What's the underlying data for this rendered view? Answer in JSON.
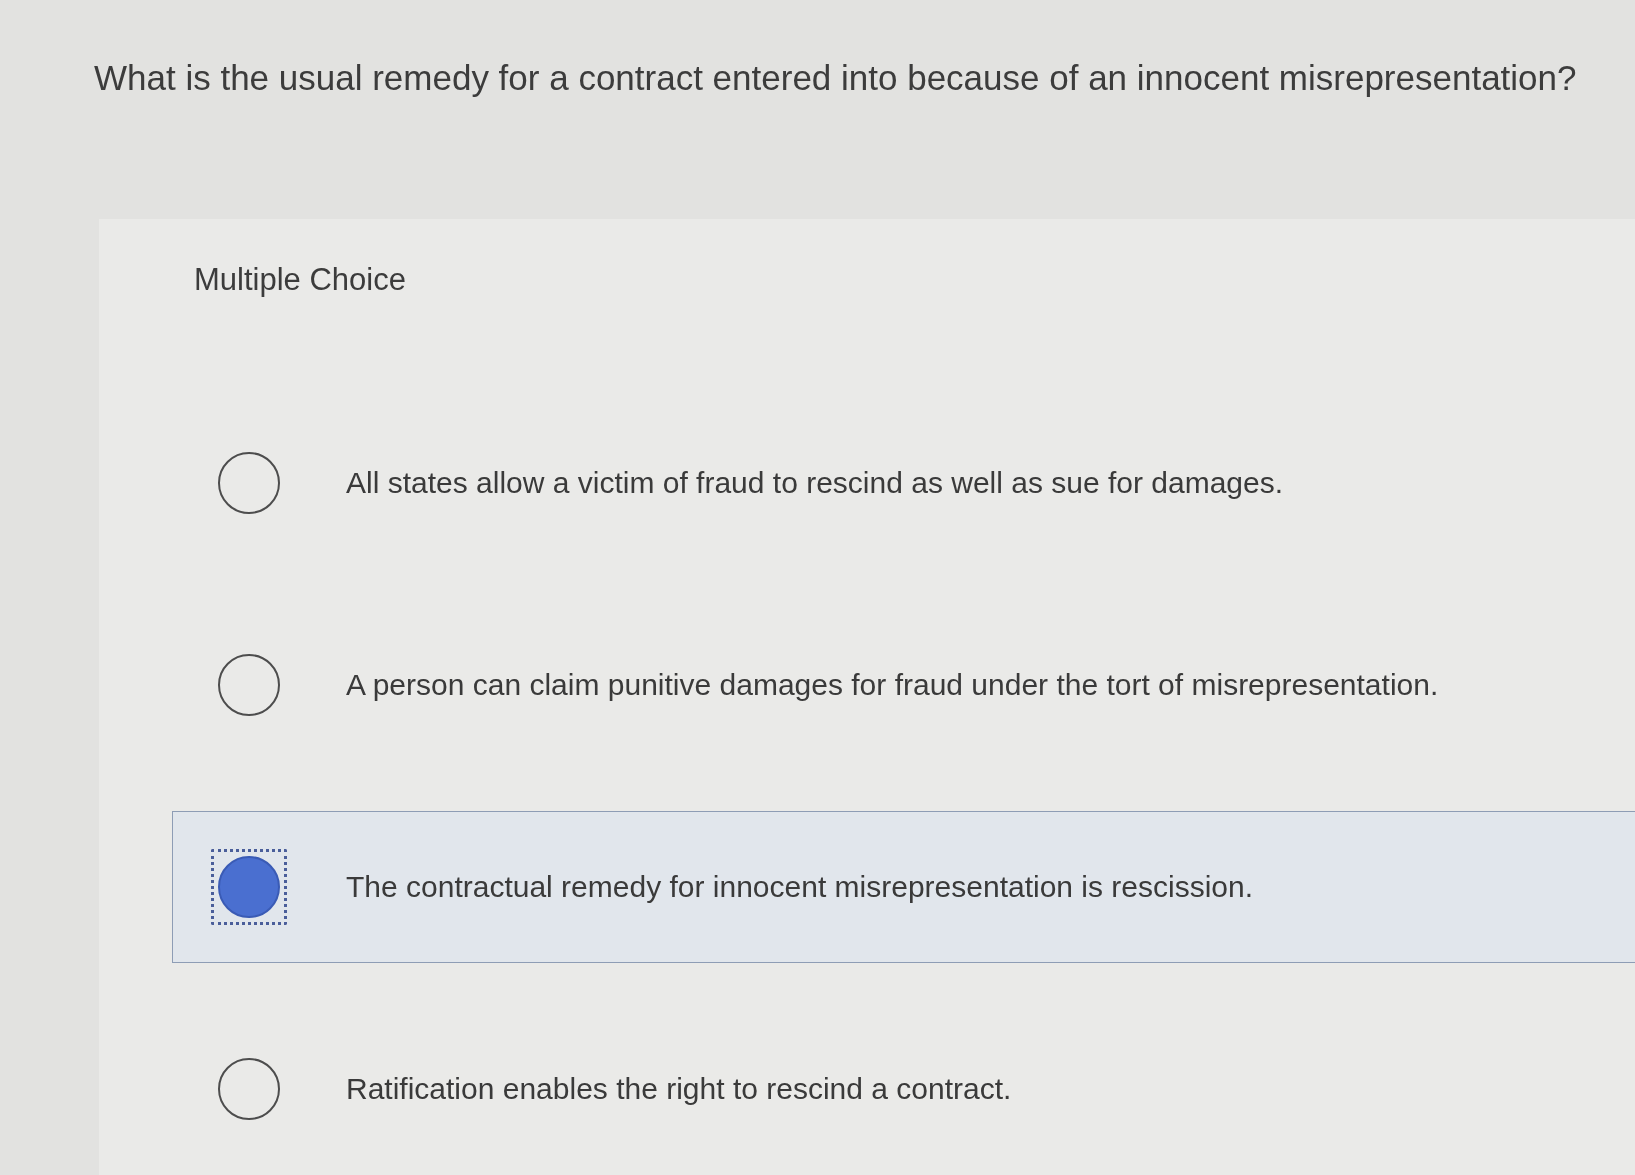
{
  "question": "What is the usual remedy for a contract entered into because of an innocent misrepresentation?",
  "section_label": "Multiple Choice",
  "options": [
    {
      "text": "All states allow a victim of fraud to rescind as well as sue for damages.",
      "selected": false
    },
    {
      "text": "A person can claim punitive damages for fraud under the tort of misrepresentation.",
      "selected": false
    },
    {
      "text": "The contractual remedy for innocent misrepresentation is rescission.",
      "selected": true
    },
    {
      "text": "Ratification enables the right to rescind a contract.",
      "selected": false
    }
  ]
}
